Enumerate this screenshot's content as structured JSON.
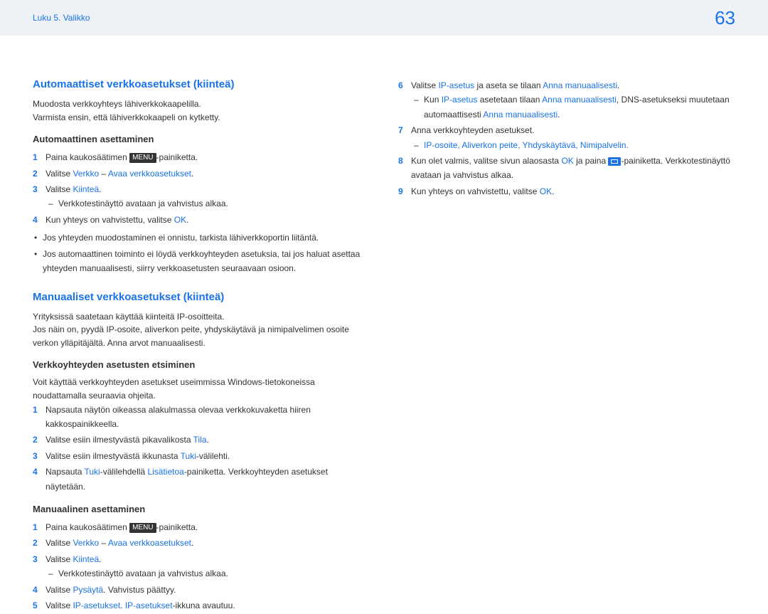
{
  "header": {
    "breadcrumb": "Luku 5. Valikko",
    "page": "63"
  },
  "left": {
    "h1": "Automaattiset verkkoasetukset (kiinteä)",
    "p1": "Muodosta verkkoyhteys lähiverkkokaapelilla.",
    "p2": "Varmista ensin, että lähiverkkokaapeli on kytketty.",
    "h2": "Automaattinen asettaminen",
    "auto": {
      "i1a": "Paina kaukosäätimen ",
      "menu": "MENU",
      "i1b": "-painiketta.",
      "i2a": "Valitse ",
      "i2b": "Verkko",
      "i2c": " – ",
      "i2d": "Avaa verkkoasetukset",
      "i2e": ".",
      "i3a": "Valitse ",
      "i3b": "Kiinteä",
      "i3c": ".",
      "i3dash": "Verkkotestinäyttö avataan ja vahvistus alkaa.",
      "i4a": "Kun yhteys on vahvistettu, valitse ",
      "i4b": "OK",
      "i4c": "."
    },
    "bul1": "Jos yhteyden muodostaminen ei onnistu, tarkista lähiverkkoportin liitäntä.",
    "bul2": "Jos automaattinen toiminto ei löydä verkkoyhteyden asetuksia, tai jos haluat asettaa yhteyden manuaalisesti, siirry verkkoasetusten seuraavaan osioon.",
    "h3": "Manuaaliset verkkoasetukset (kiinteä)",
    "p3": "Yrityksissä saatetaan käyttää kiinteitä IP-osoitteita.",
    "p4": "Jos näin on, pyydä IP-osoite, aliverkon peite, yhdyskäytävä ja nimipalvelimen osoite verkon ylläpitäjältä. Anna arvot manuaalisesti.",
    "h4": "Verkkoyhteyden asetusten etsiminen",
    "p5": "Voit käyttää verkkoyhteyden asetukset useimmissa Windows-tietokoneissa noudattamalla seuraavia ohjeita.",
    "find": {
      "i1": "Napsauta näytön oikeassa alakulmassa olevaa verkkokuvaketta hiiren kakkospainikkeella.",
      "i2a": "Valitse esiin ilmestyvästä pikavalikosta ",
      "i2b": "Tila",
      "i2c": ".",
      "i3a": "Valitse esiin ilmestyvästä ikkunasta ",
      "i3b": "Tuki",
      "i3c": "-välilehti.",
      "i4a": "Napsauta ",
      "i4b": "Tuki",
      "i4c": "-välilehdellä ",
      "i4d": "Lisätietoa",
      "i4e": "-painiketta. Verkkoyhteyden asetukset näytetään."
    },
    "h5": "Manuaalinen asettaminen",
    "man": {
      "i1a": "Paina kaukosäätimen ",
      "menu": "MENU",
      "i1b": "-painiketta.",
      "i2a": "Valitse ",
      "i2b": "Verkko",
      "i2c": " – ",
      "i2d": "Avaa verkkoasetukset",
      "i2e": ".",
      "i3a": "Valitse ",
      "i3b": "Kiinteä",
      "i3c": ".",
      "i3dash": "Verkkotestinäyttö avataan ja vahvistus alkaa.",
      "i4a": "Valitse ",
      "i4b": "Pysäytä",
      "i4c": ". Vahvistus päättyy.",
      "i5a": "Valitse ",
      "i5b": "IP-asetukset",
      "i5c": ". ",
      "i5d": "IP-asetukset",
      "i5e": "-ikkuna avautuu."
    }
  },
  "right": {
    "r6a": "Valitse ",
    "r6b": "IP-asetus",
    "r6c": " ja aseta se tilaan ",
    "r6d": "Anna manuaalisesti",
    "r6e": ".",
    "r6dash_a": "Kun ",
    "r6dash_b": "IP-asetus",
    "r6dash_c": " asetetaan tilaan ",
    "r6dash_d": "Anna manuaalisesti",
    "r6dash_e": ", DNS-asetukseksi muutetaan automaattisesti ",
    "r6dash_f": "Anna manuaalisesti",
    "r6dash_g": ".",
    "r7": "Anna verkkoyhteyden asetukset.",
    "r7dash": "IP-osoite, Aliverkon peite, Yhdyskäytävä, Nimipalvelin.",
    "r8a": "Kun olet valmis, valitse sivun alaosasta ",
    "r8b": "OK",
    "r8c": " ja paina ",
    "r8d": "-painiketta. Verkkotestinäyttö avataan ja vahvistus alkaa.",
    "r9a": "Kun yhteys on vahvistettu, valitse ",
    "r9b": "OK",
    "r9c": "."
  }
}
